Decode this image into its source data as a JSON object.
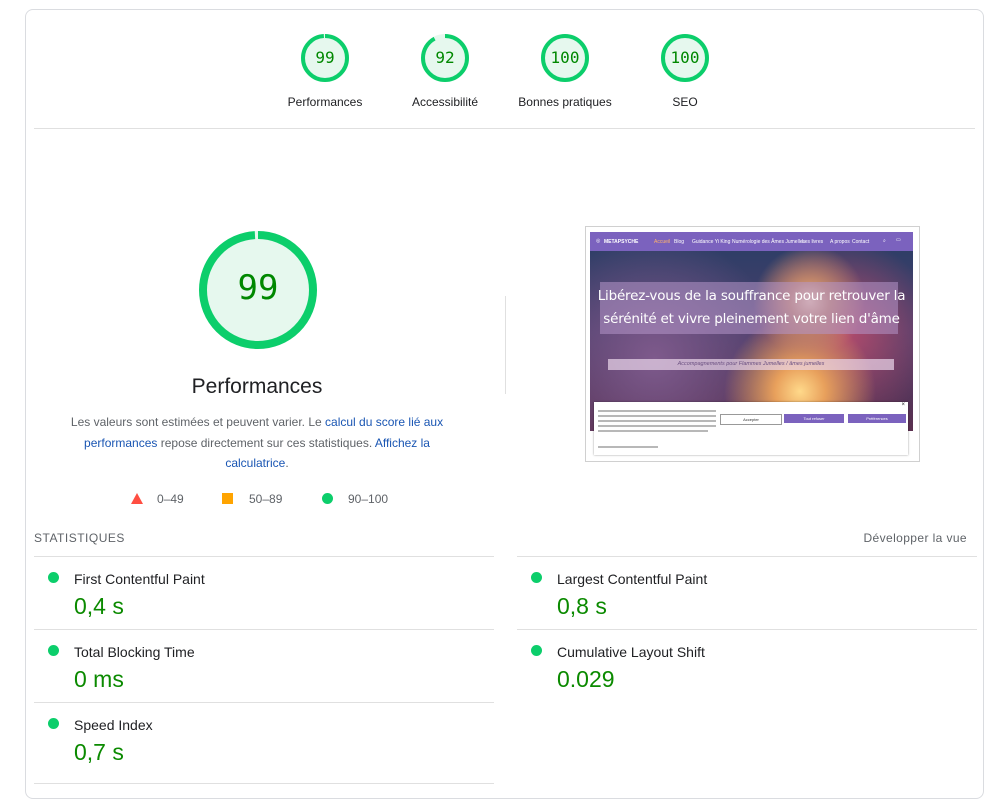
{
  "categories": [
    {
      "label": "Performances",
      "score": "99",
      "value": 0.99,
      "color": "#0cce6b"
    },
    {
      "label": "Accessibilité",
      "score": "92",
      "value": 0.92,
      "color": "#0cce6b"
    },
    {
      "label": "Bonnes pratiques",
      "score": "100",
      "value": 1.0,
      "color": "#0cce6b"
    },
    {
      "label": "SEO",
      "score": "100",
      "value": 1.0,
      "color": "#0cce6b"
    }
  ],
  "performance": {
    "score": "99",
    "title": "Performances",
    "desc_part1": "Les valeurs sont estimées et peuvent varier. Le ",
    "desc_link1": "calcul du score lié aux performances",
    "desc_part2": " repose directement sur ces statistiques. ",
    "desc_link2": "Affichez la calculatrice",
    "desc_part3": "."
  },
  "legend": [
    {
      "range": "0–49",
      "shape": "triangle",
      "color": "#ff4e42"
    },
    {
      "range": "50–89",
      "shape": "square",
      "color": "#ffa400"
    },
    {
      "range": "90–100",
      "shape": "circle",
      "color": "#0cce6b"
    }
  ],
  "screenshot": {
    "brand": "METAPSYCHE",
    "nav_items": [
      "Accueil",
      "Blog",
      "Guidance Yi King",
      "Numérologie des Âmes Jumelles",
      "Les livres",
      "A propos",
      "Contact"
    ],
    "hero_title": "Libérez-vous de la souffrance pour retrouver la sérénité et vivre pleinement votre lien d'âme",
    "hero_subtitle": "Accompagnements pour Flammes Jumelles / âmes jumelles",
    "cookie_accept": "Accepter",
    "cookie_refuse": "Tout refuser",
    "cookie_prefs": "Préférences"
  },
  "statistics": {
    "heading": "STATISTIQUES",
    "expand": "Développer la vue",
    "metrics": [
      {
        "title": "First Contentful Paint",
        "value": "0,4 s"
      },
      {
        "title": "Largest Contentful Paint",
        "value": "0,8 s"
      },
      {
        "title": "Total Blocking Time",
        "value": "0 ms"
      },
      {
        "title": "Cumulative Layout Shift",
        "value": "0.029"
      },
      {
        "title": "Speed Index",
        "value": "0,7 s"
      }
    ]
  }
}
